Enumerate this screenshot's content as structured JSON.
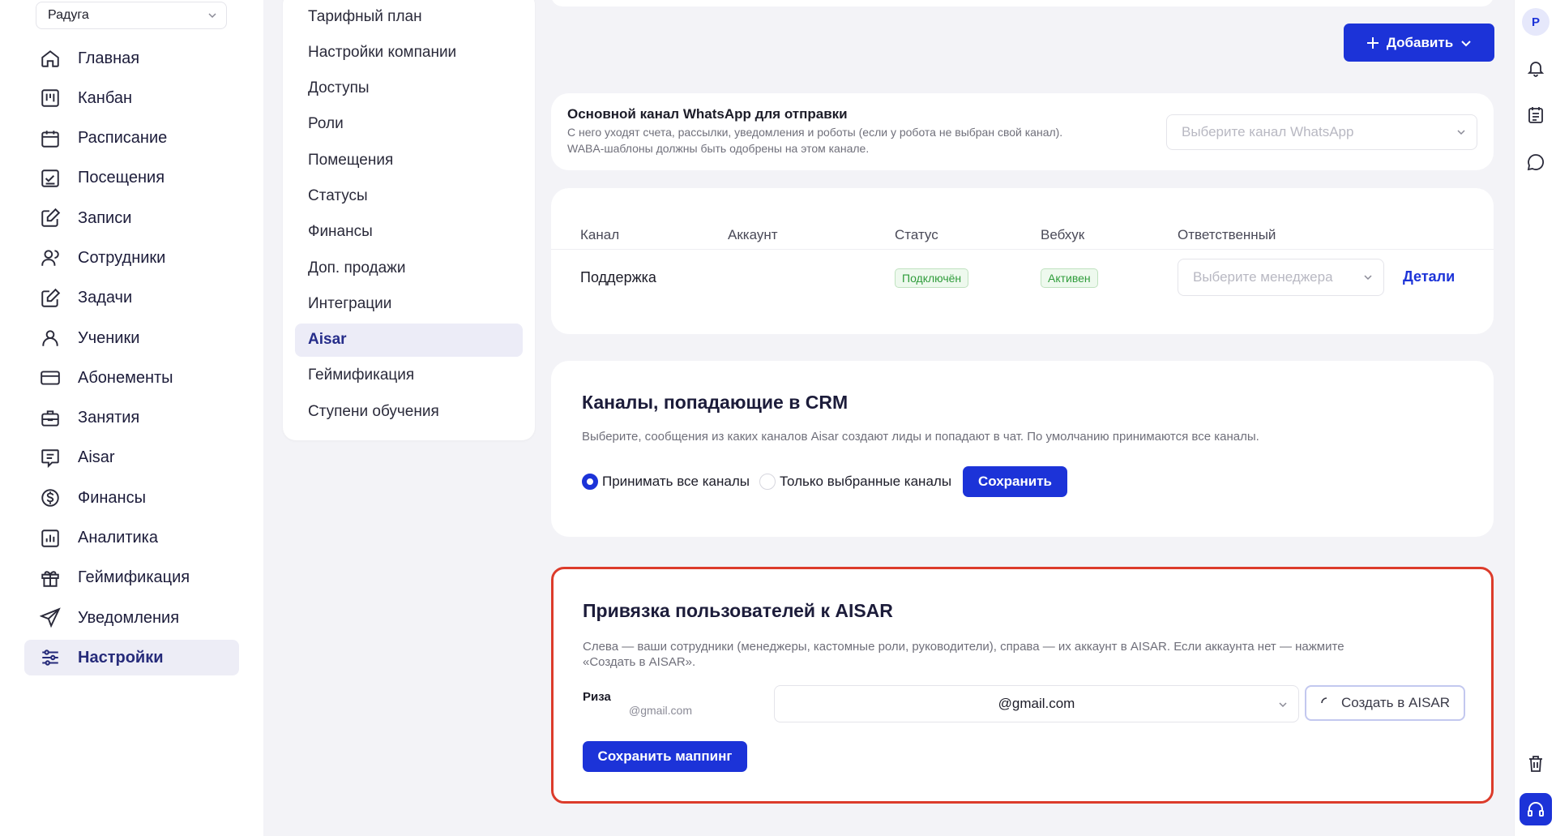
{
  "sidebar": {
    "org": "Радуга",
    "items": [
      {
        "label": "Главная",
        "icon": "home-icon"
      },
      {
        "label": "Канбан",
        "icon": "kanban-icon"
      },
      {
        "label": "Расписание",
        "icon": "calendar-icon"
      },
      {
        "label": "Посещения",
        "icon": "attendance-icon"
      },
      {
        "label": "Записи",
        "icon": "edit-icon"
      },
      {
        "label": "Сотрудники",
        "icon": "staff-icon"
      },
      {
        "label": "Задачи",
        "icon": "tasks-icon"
      },
      {
        "label": "Ученики",
        "icon": "student-icon"
      },
      {
        "label": "Абонементы",
        "icon": "card-icon"
      },
      {
        "label": "Занятия",
        "icon": "briefcase-icon"
      },
      {
        "label": "Aisar",
        "icon": "chat-icon"
      },
      {
        "label": "Финансы",
        "icon": "dollar-icon"
      },
      {
        "label": "Аналитика",
        "icon": "analytics-icon"
      },
      {
        "label": "Геймификация",
        "icon": "gift-icon"
      },
      {
        "label": "Уведомления",
        "icon": "send-icon"
      },
      {
        "label": "Настройки",
        "icon": "sliders-icon",
        "active": true
      }
    ]
  },
  "settings_menu": {
    "items": [
      {
        "label": "Тарифный план"
      },
      {
        "label": "Настройки компании"
      },
      {
        "label": "Доступы"
      },
      {
        "label": "Роли"
      },
      {
        "label": "Помещения"
      },
      {
        "label": "Статусы"
      },
      {
        "label": "Финансы"
      },
      {
        "label": "Доп. продажи"
      },
      {
        "label": "Интеграции"
      },
      {
        "label": "Aisar",
        "active": true
      },
      {
        "label": "Геймификация"
      },
      {
        "label": "Ступени обучения"
      }
    ]
  },
  "toolbar": {
    "add_label": "Добавить"
  },
  "whatsapp": {
    "title": "Основной канал WhatsApp для отправки",
    "desc_line1": "С него уходят счета, рассылки, уведомления и роботы (если у робота не выбран свой канал).",
    "desc_line2": "WABA-шаблоны должны быть одобрены на этом канале.",
    "select_placeholder": "Выберите канал WhatsApp"
  },
  "channels_table": {
    "headers": [
      "Канал",
      "Аккаунт",
      "Статус",
      "Вебхук",
      "Ответственный"
    ],
    "rows": [
      {
        "channel": "Поддержка",
        "account": "",
        "status": "Подключён",
        "webhook": "Активен",
        "manager_placeholder": "Выберите менеджера",
        "action": "Детали"
      }
    ]
  },
  "crm_channels": {
    "title": "Каналы, попадающие в CRM",
    "desc": "Выберите, сообщения из каких каналов Aisar создают лиды и попадают в чат. По умолчанию принимаются все каналы.",
    "option_all": "Принимать все каналы",
    "option_selected": "Только выбранные каналы",
    "selected_option": "all",
    "save_label": "Сохранить"
  },
  "aisar_mapping": {
    "title": "Привязка пользователей к AISAR",
    "desc_line1": "Слева — ваши сотрудники (менеджеры, кастомные роли, руководители), справа — их аккаунт в AISAR. Если аккаунта нет — нажмите",
    "desc_line2": "«Создать в AISAR».",
    "users": [
      {
        "name": "Риза",
        "email": "@gmail.com",
        "aisar_account": "@gmail.com",
        "create_label": "Создать в AISAR"
      }
    ],
    "save_label": "Сохранить маппинг"
  },
  "right_rail": {
    "avatar_initial": "Р",
    "icons": [
      "bell-icon",
      "document-icon",
      "chat-bubble-icon",
      "trash-icon",
      "headset-icon"
    ]
  },
  "colors": {
    "accent": "#1c33d8",
    "highlight_border": "#dc3b2b",
    "status_green": "#2f9c3b"
  }
}
